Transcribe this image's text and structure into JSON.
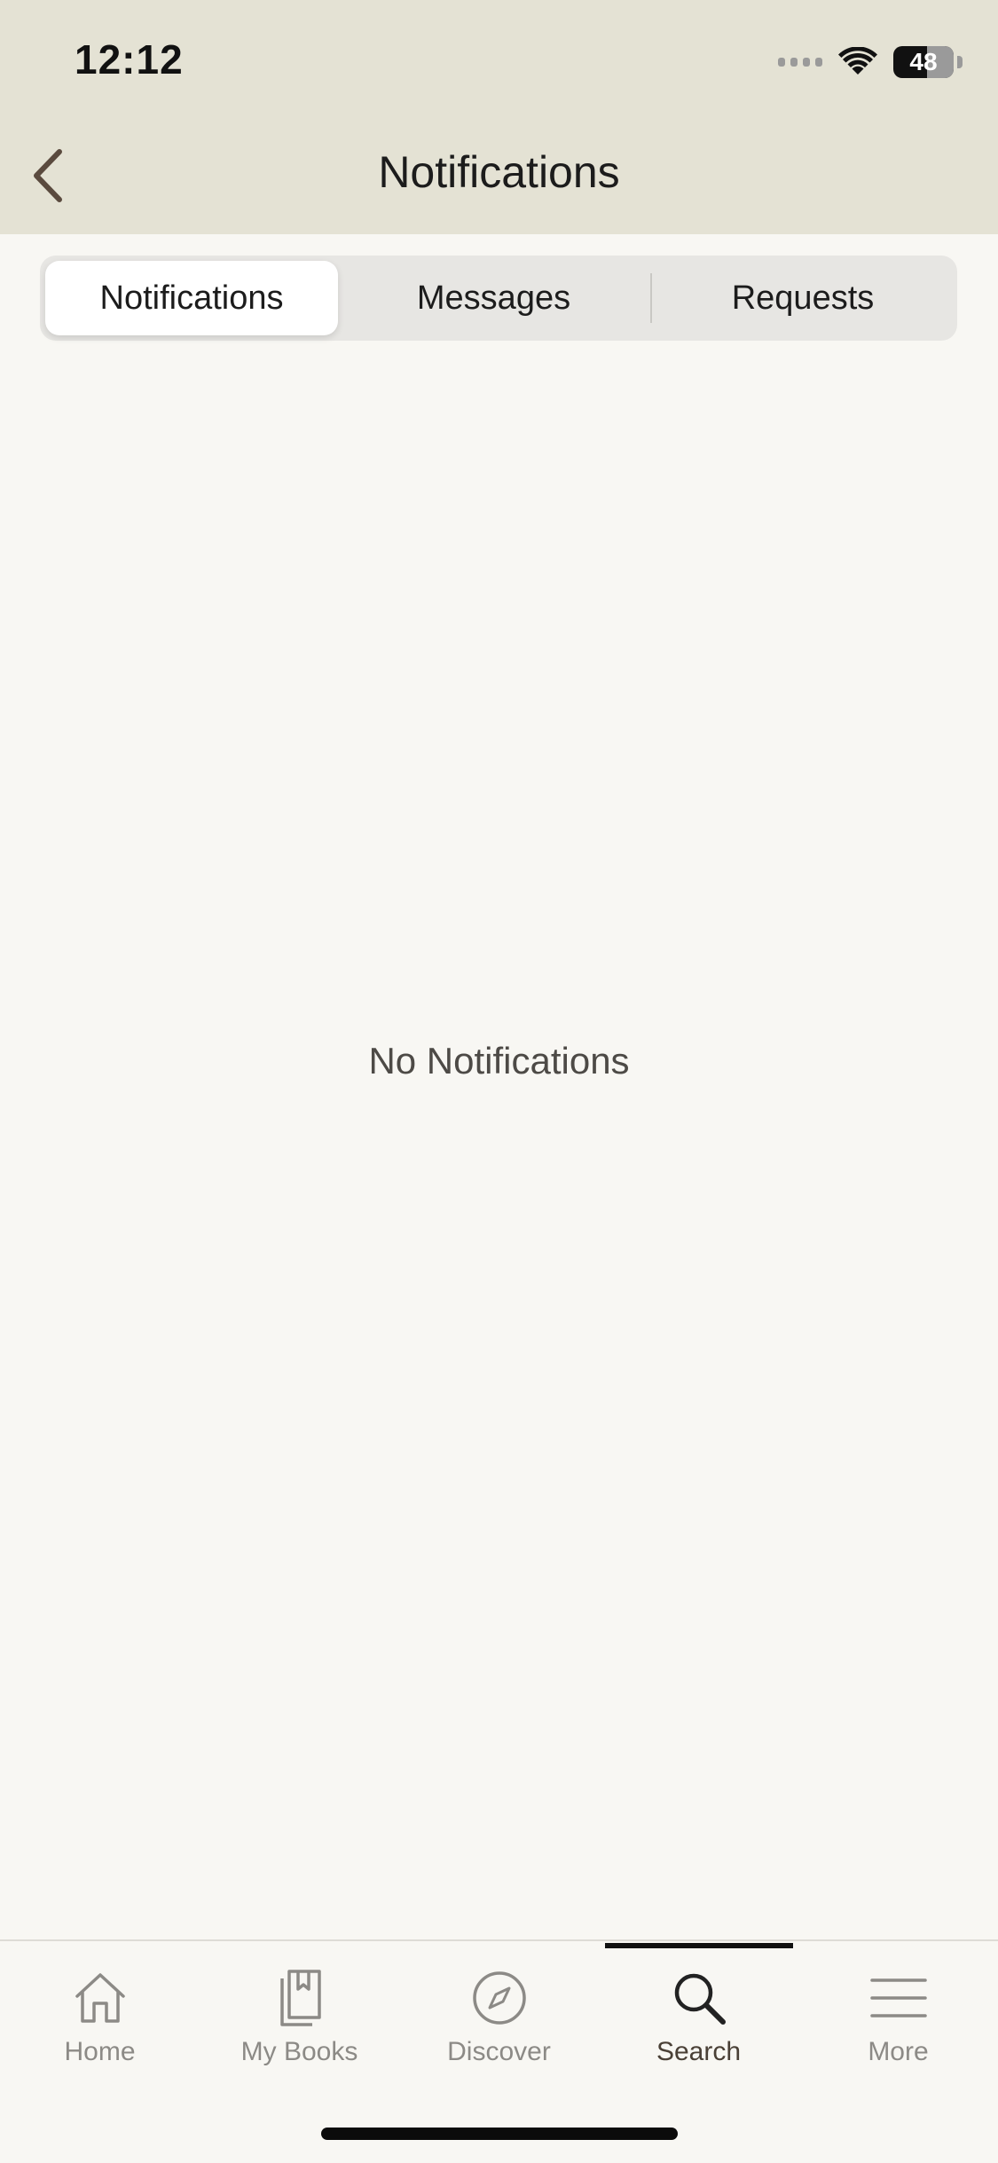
{
  "status_bar": {
    "time": "12:12",
    "battery": "48"
  },
  "nav": {
    "title": "Notifications",
    "back_icon": "chevron-left-icon"
  },
  "segments": [
    {
      "label": "Notifications",
      "selected": true
    },
    {
      "label": "Messages",
      "selected": false
    },
    {
      "label": "Requests",
      "selected": false
    }
  ],
  "empty_state": {
    "text": "No Notifications"
  },
  "tabbar": {
    "items": [
      {
        "label": "Home",
        "icon": "home-icon",
        "active": false
      },
      {
        "label": "My Books",
        "icon": "books-icon",
        "active": false
      },
      {
        "label": "Discover",
        "icon": "compass-icon",
        "active": false
      },
      {
        "label": "Search",
        "icon": "search-icon",
        "active": true
      },
      {
        "label": "More",
        "icon": "menu-icon",
        "active": false
      }
    ]
  },
  "colors": {
    "header_bg": "#e4e2d4",
    "page_bg": "#f8f7f3",
    "accent": "#4a4036",
    "inactive": "#8c8a86"
  }
}
